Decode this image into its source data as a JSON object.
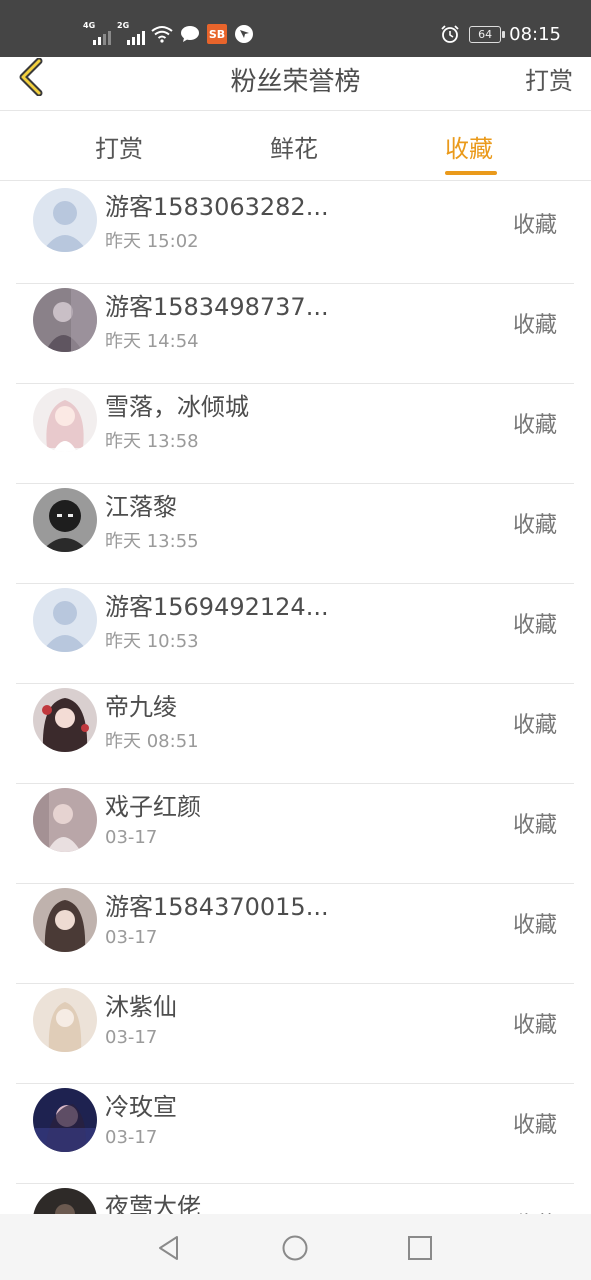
{
  "status_bar": {
    "signal1": "4G",
    "signal2": "2G",
    "app_badge": "SB",
    "battery": "64",
    "time": "08:15"
  },
  "header": {
    "title": "粉丝荣誉榜",
    "action": "打赏"
  },
  "tabs": [
    {
      "label": "打赏",
      "active": false
    },
    {
      "label": "鲜花",
      "active": false
    },
    {
      "label": "收藏",
      "active": true
    }
  ],
  "fans": [
    {
      "name": "游客1583063282...",
      "time": "昨天 15:02",
      "action": "收藏",
      "avatar": "default-avatar"
    },
    {
      "name": "游客1583498737...",
      "time": "昨天 14:54",
      "action": "收藏",
      "avatar": "photo-avatar"
    },
    {
      "name": "雪落，冰倾城",
      "time": "昨天 13:58",
      "action": "收藏",
      "avatar": "anime-avatar"
    },
    {
      "name": "江落黎",
      "time": "昨天 13:55",
      "action": "收藏",
      "avatar": "dark-portrait-avatar"
    },
    {
      "name": "游客1569492124...",
      "time": "昨天 10:53",
      "action": "收藏",
      "avatar": "default-avatar"
    },
    {
      "name": "帝九绫",
      "time": "昨天 08:51",
      "action": "收藏",
      "avatar": "anime-avatar"
    },
    {
      "name": "戏子红颜",
      "time": "03-17",
      "action": "收藏",
      "avatar": "photo-avatar"
    },
    {
      "name": "游客1584370015...",
      "time": "03-17",
      "action": "收藏",
      "avatar": "anime-avatar"
    },
    {
      "name": "沐紫仙",
      "time": "03-17",
      "action": "收藏",
      "avatar": "photo-avatar"
    },
    {
      "name": "冷玫宣",
      "time": "03-17",
      "action": "收藏",
      "avatar": "photo-avatar"
    },
    {
      "name": "夜莺大佬",
      "time": "",
      "action": "收藏",
      "avatar": "dark-portrait-avatar"
    }
  ],
  "colors": {
    "accent": "#ea9a1b",
    "status_bar": "#454545",
    "divider": "#e6e6e6"
  }
}
